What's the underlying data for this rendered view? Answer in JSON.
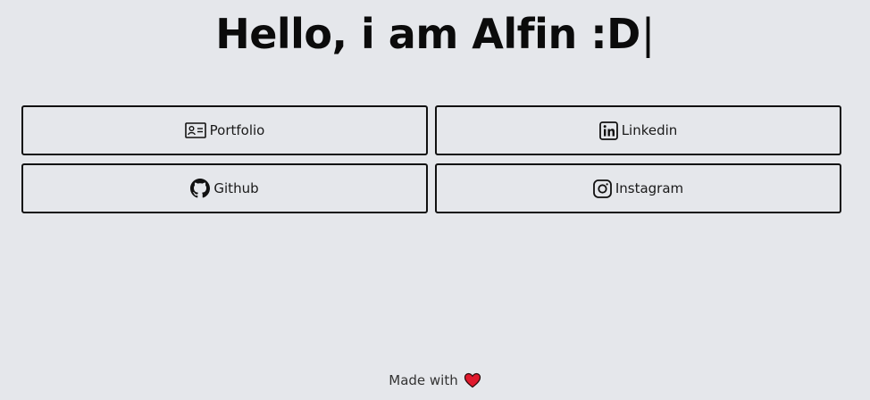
{
  "header": {
    "title": "Hello, i am Alfin :D",
    "cursor": "|"
  },
  "links": [
    {
      "label": "Portfolio",
      "icon": "id-card-icon"
    },
    {
      "label": "Linkedin",
      "icon": "linkedin-icon"
    },
    {
      "label": "Github",
      "icon": "github-icon"
    },
    {
      "label": "Instagram",
      "icon": "instagram-icon"
    }
  ],
  "footer": {
    "text": "Made with",
    "icon": "heart-icon"
  },
  "colors": {
    "background": "#e5e7eb",
    "border": "#111111",
    "heart": "#e0192d"
  }
}
